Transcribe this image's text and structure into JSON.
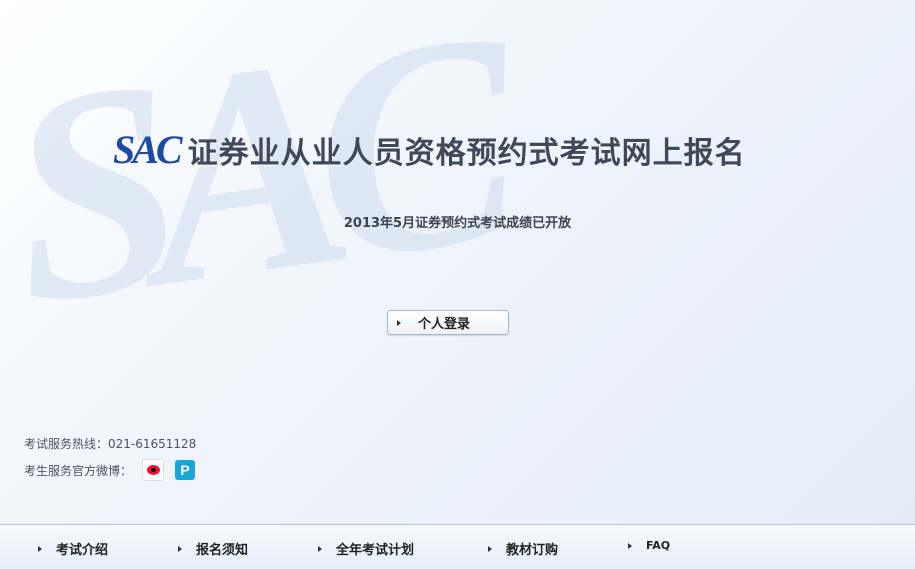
{
  "watermark": {
    "text": "SAC"
  },
  "header": {
    "logo": "SAC",
    "title": "证券业从业人员资格预约式考试网上报名"
  },
  "notice": "2013年5月证券预约式考试成绩已开放",
  "login_button": {
    "label": "个人登录"
  },
  "contact": {
    "hotline": "考试服务热线：021-61651128",
    "weibo_label": "考生服务官方微博：",
    "icons": [
      "sina-weibo-icon",
      "tencent-weibo-icon"
    ]
  },
  "footer_nav": [
    {
      "label": "考试介绍"
    },
    {
      "label": "报名须知"
    },
    {
      "label": "全年考试计划"
    },
    {
      "label": "教材订购"
    },
    {
      "label": "FAQ"
    }
  ],
  "colors": {
    "logo_blue": "#1f4aa2",
    "title_gray": "#40495a",
    "tencent_blue": "#19a6d8",
    "sina_red": "#e6162d"
  }
}
